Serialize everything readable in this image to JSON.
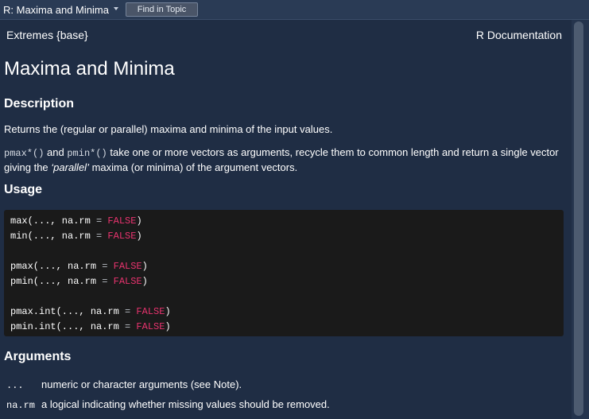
{
  "topbar": {
    "title": "R: Maxima and Minima",
    "find_label": "Find in Topic"
  },
  "doc": {
    "package_ref": "Extremes {base}",
    "doc_label": "R Documentation",
    "title": "Maxima and Minima",
    "description": {
      "heading": "Description",
      "para1": "Returns the (regular or parallel) maxima and minima of the input values.",
      "para2_code1": "pmax*()",
      "para2_text1": " and ",
      "para2_code2": "pmin*()",
      "para2_text2": " take one or more vectors as arguments, recycle them to common length and return a single vector giving the ",
      "para2_em": "‘parallel’",
      "para2_text3": " maxima (or minima) of the argument vectors."
    },
    "usage": {
      "heading": "Usage",
      "lines": [
        {
          "fn": "max(..., na.rm ",
          "eq": "=",
          "val": " FALSE",
          "close": ")"
        },
        {
          "fn": "min(..., na.rm ",
          "eq": "=",
          "val": " FALSE",
          "close": ")"
        },
        {
          "fn": "pmax(..., na.rm ",
          "eq": "=",
          "val": " FALSE",
          "close": ")"
        },
        {
          "fn": "pmin(..., na.rm ",
          "eq": "=",
          "val": " FALSE",
          "close": ")"
        },
        {
          "fn": "pmax.int(..., na.rm ",
          "eq": "=",
          "val": " FALSE",
          "close": ")"
        },
        {
          "fn": "pmin.int(..., na.rm ",
          "eq": "=",
          "val": " FALSE",
          "close": ")"
        }
      ]
    },
    "arguments": {
      "heading": "Arguments",
      "items": [
        {
          "name": "...",
          "desc": "numeric or character arguments (see Note)."
        },
        {
          "name": "na.rm",
          "desc": "a logical indicating whether missing values should be removed."
        }
      ]
    }
  },
  "colors": {
    "background": "#1f2d44",
    "code_background": "#1a1a1a",
    "keyword": "#e8336e"
  }
}
